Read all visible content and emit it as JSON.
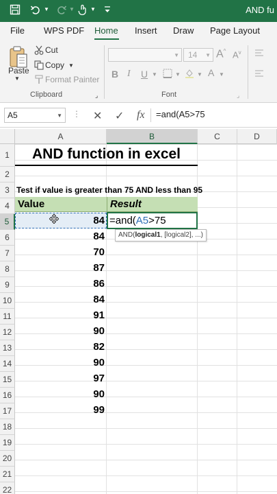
{
  "titlebar": {
    "title": "AND fu",
    "icons": [
      "save-icon",
      "undo-icon",
      "redo-icon",
      "touch-mode-icon",
      "customize-qat-icon"
    ]
  },
  "tabs": [
    {
      "label": "File"
    },
    {
      "label": "WPS PDF"
    },
    {
      "label": "Home",
      "active": true
    },
    {
      "label": "Insert"
    },
    {
      "label": "Draw"
    },
    {
      "label": "Page Layout"
    }
  ],
  "ribbon": {
    "paste_label": "Paste",
    "cut_label": "Cut",
    "copy_label": "Copy",
    "format_painter_label": "Format Painter",
    "clipboard_group": "Clipboard",
    "font_size": "14",
    "font_group": "Font"
  },
  "formula_bar": {
    "name_box": "A5",
    "formula": "=and(A5>75"
  },
  "columns": [
    "A",
    "B",
    "C",
    "D"
  ],
  "rows": [
    "1",
    "2",
    "3",
    "4",
    "5",
    "6",
    "7",
    "8",
    "9",
    "10",
    "11",
    "12",
    "13",
    "14",
    "15",
    "16",
    "17",
    "18",
    "19",
    "20",
    "21",
    "22"
  ],
  "sheet": {
    "title": "AND function in excel",
    "description": "Test if value is greater than 75 AND less than 95",
    "header_value": "Value",
    "header_result": "Result",
    "values": [
      "84",
      "84",
      "70",
      "87",
      "86",
      "84",
      "91",
      "90",
      "82",
      "90",
      "97",
      "90",
      "99"
    ],
    "edit_prefix": "=and(",
    "edit_ref": "A5",
    "edit_suffix": ">75",
    "tooltip_fn": "AND(",
    "tooltip_arg1": "logical1",
    "tooltip_rest": ", [logical2], ...)"
  },
  "colors": {
    "accent": "#217346",
    "header_fill": "#c5dfb4",
    "ref_blue": "#2f6eb5"
  }
}
